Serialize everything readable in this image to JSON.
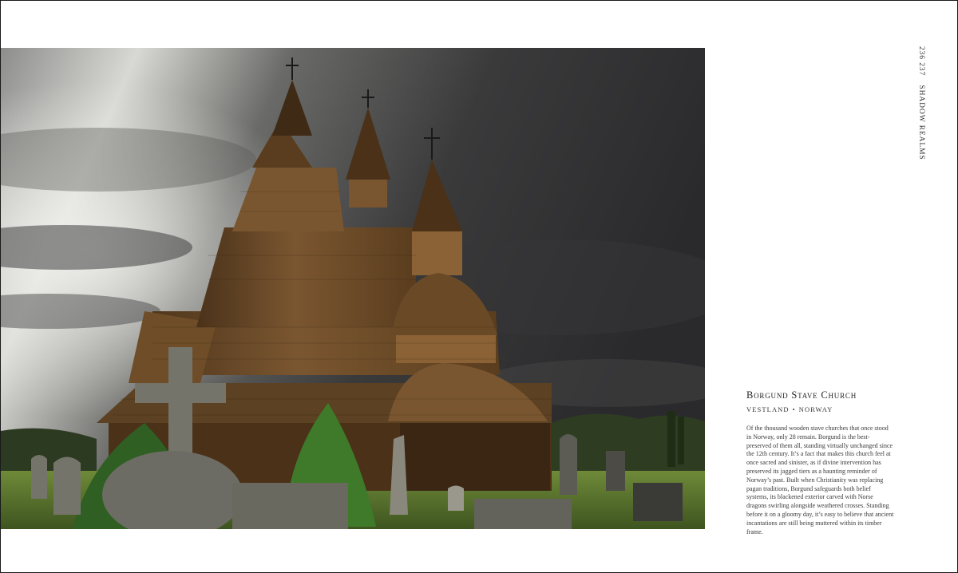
{
  "running_head": {
    "pages": "236 237",
    "section": "SHADOW REALMS"
  },
  "photo": {
    "subject": "Borgund Stave Church under stormy sky with graveyard",
    "colors": {
      "sky_dark": "#2b2b2d",
      "sky_light": "#d9d9d6",
      "wood": "#6b4a26",
      "wood_dark": "#3b2612",
      "grass": "#5f7a2e",
      "stone": "#7d7c72"
    }
  },
  "caption": {
    "title": "Borgund Stave Church",
    "region": "VESTLAND",
    "separator": "•",
    "country": "NORWAY",
    "body": "Of the thousand wooden stave churches that once stood in Norway, only 28 remain. Borgund is the best-preserved of them all, standing virtually unchanged since the 12th century. It’s a fact that makes this church feel at once sacred and sinister, as if divine intervention has preserved its jagged tiers as a haunting reminder of Norway’s past. Built when Christianity was replacing pagan traditions, Borgund safeguards both belief systems, its blackened exterior carved with Norse dragons swirling alongside weathered crosses. Standing before it on a gloomy day, it’s easy to believe that ancient incantations are still being muttered within its timber frame."
  }
}
